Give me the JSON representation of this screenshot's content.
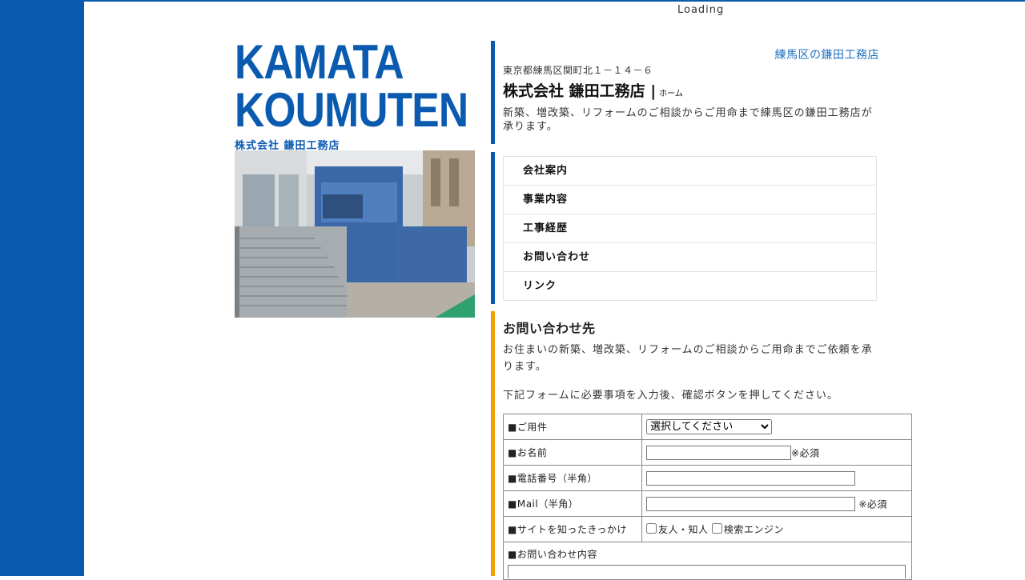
{
  "loading_text": "Loading",
  "logo": {
    "line1": "KAMATA",
    "line2": "KOUMUTEN",
    "subtitle": "株式会社 鎌田工務店"
  },
  "header": {
    "tagline": "練馬区の鎌田工務店",
    "address": "東京都練馬区関町北１－１４－６",
    "company_title": "株式会社 鎌田工務店 |",
    "home_label": "ホーム",
    "description": "新築、増改築、リフォームのご相談からご用命まで練馬区の鎌田工務店が承ります。"
  },
  "nav": {
    "items": [
      {
        "label": "会社案内"
      },
      {
        "label": "事業内容"
      },
      {
        "label": "工事経歴"
      },
      {
        "label": "お問い合わせ"
      },
      {
        "label": "リンク"
      }
    ]
  },
  "contact": {
    "heading": "お問い合わせ先",
    "intro": "お住まいの新築、増改築、リフォームのご相談からご用命までご依頼を承ります。",
    "instruction": "下記フォームに必要事項を入力後、確認ボタンを押してください。",
    "form": {
      "purpose_label": "■ご用件",
      "purpose_selected": "選択してください",
      "name_label": "■お名前",
      "name_required": "※必須",
      "phone_label": "■電話番号（半角）",
      "mail_label": "■Mail（半角）",
      "mail_required": "※必須",
      "source_label": "■サイトを知ったきっかけ",
      "source_options": [
        "友人・知人",
        "検索エンジン"
      ],
      "message_label": "■お問い合わせ内容"
    }
  },
  "colors": {
    "brand_blue": "#0a5ab0",
    "accent_orange": "#f0a000",
    "link_blue": "#1d6fc0"
  }
}
